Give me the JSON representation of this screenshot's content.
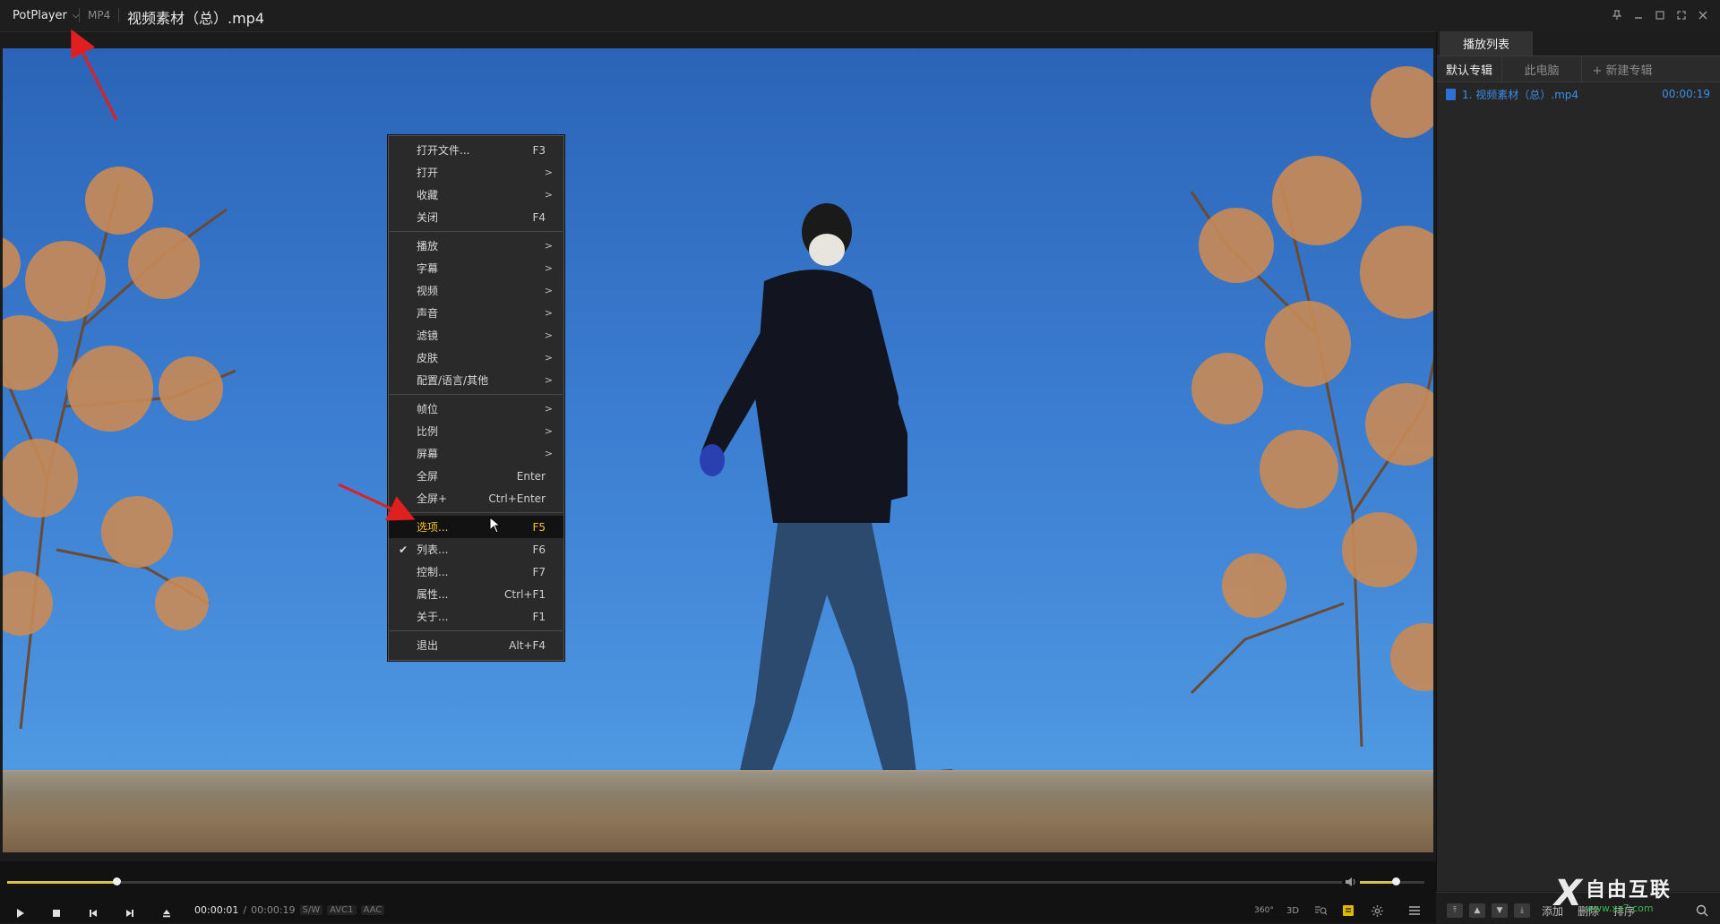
{
  "titlebar": {
    "app_name": "PotPlayer",
    "format": "MP4",
    "file_title": "视频素材（总）.mp4"
  },
  "context_menu": {
    "groups": [
      [
        {
          "label": "打开文件...",
          "key": "F3",
          "submenu": false
        },
        {
          "label": "打开",
          "key": "",
          "submenu": true
        },
        {
          "label": "收藏",
          "key": "",
          "submenu": true
        },
        {
          "label": "关闭",
          "key": "F4",
          "submenu": false
        }
      ],
      [
        {
          "label": "播放",
          "key": "",
          "submenu": true
        },
        {
          "label": "字幕",
          "key": "",
          "submenu": true
        },
        {
          "label": "视频",
          "key": "",
          "submenu": true
        },
        {
          "label": "声音",
          "key": "",
          "submenu": true
        },
        {
          "label": "滤镜",
          "key": "",
          "submenu": true
        },
        {
          "label": "皮肤",
          "key": "",
          "submenu": true
        },
        {
          "label": "配置/语言/其他",
          "key": "",
          "submenu": true
        }
      ],
      [
        {
          "label": "帧位",
          "key": "",
          "submenu": true
        },
        {
          "label": "比例",
          "key": "",
          "submenu": true
        },
        {
          "label": "屏幕",
          "key": "",
          "submenu": true
        },
        {
          "label": "全屏",
          "key": "Enter",
          "submenu": false
        },
        {
          "label": "全屏+",
          "key": "Ctrl+Enter",
          "submenu": false
        }
      ],
      [
        {
          "label": "选项...",
          "key": "F5",
          "submenu": false,
          "highlighted": true
        },
        {
          "label": "列表...",
          "key": "F6",
          "submenu": false,
          "checked": true
        },
        {
          "label": "控制...",
          "key": "F7",
          "submenu": false
        },
        {
          "label": "属性...",
          "key": "Ctrl+F1",
          "submenu": false
        },
        {
          "label": "关于...",
          "key": "F1",
          "submenu": false
        }
      ],
      [
        {
          "label": "退出",
          "key": "Alt+F4",
          "submenu": false
        }
      ]
    ]
  },
  "playlist": {
    "panel_tab": "播放列表",
    "sub_tabs": [
      "默认专辑",
      "此电脑",
      "+ 新建专辑"
    ],
    "items": [
      {
        "name": "1. 视频素材（总）.mp4",
        "duration": "00:00:19"
      }
    ],
    "bottom_buttons": [
      "添加",
      "删除",
      "排序"
    ]
  },
  "controls": {
    "current_time": "00:00:01",
    "separator": "/",
    "total_time": "00:00:19",
    "badges": [
      "S/W",
      "AVC1",
      "AAC"
    ],
    "seek_progress": 0.082,
    "volume_level": 0.55,
    "right_buttons": [
      "360°",
      "3D"
    ]
  },
  "watermark": {
    "brand": "自由互联",
    "url": "www.xz7.com"
  },
  "colors": {
    "accent": "#f2c230",
    "link": "#3d8ee8",
    "annotation": "#e02020"
  }
}
